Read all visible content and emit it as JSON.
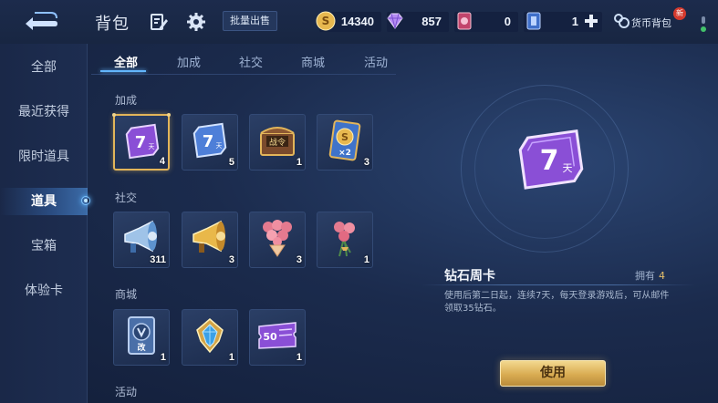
{
  "header": {
    "title": "背包",
    "bulk_sell": "批量出售",
    "currencies": {
      "coin": "14340",
      "diamond": "857",
      "card": "0",
      "ticket": "1"
    },
    "wallet_label": "货币背包",
    "new_badge": "新"
  },
  "sidebar": {
    "items": [
      {
        "label": "全部"
      },
      {
        "label": "最近获得"
      },
      {
        "label": "限时道具"
      },
      {
        "label": "道具"
      },
      {
        "label": "宝箱"
      },
      {
        "label": "体验卡"
      }
    ],
    "active": "道具"
  },
  "tabs": {
    "items": [
      {
        "label": "全部"
      },
      {
        "label": "加成"
      },
      {
        "label": "社交"
      },
      {
        "label": "商城"
      },
      {
        "label": "活动"
      }
    ],
    "active": "全部"
  },
  "sections": {
    "boost": {
      "label": "加成",
      "items": [
        {
          "icon": "diamond-week-card-icon",
          "qty": "4",
          "badge": "7",
          "badge_unit": "天"
        },
        {
          "icon": "blue-week-card-icon",
          "qty": "5",
          "badge": "7",
          "badge_unit": "天"
        },
        {
          "icon": "battle-pass-chest-icon",
          "qty": "1",
          "badge": "战令"
        },
        {
          "icon": "double-gold-card-icon",
          "qty": "3",
          "badge": "×2"
        }
      ]
    },
    "social": {
      "label": "社交",
      "items": [
        {
          "icon": "blue-megaphone-icon",
          "qty": "311"
        },
        {
          "icon": "gold-megaphone-icon",
          "qty": "3"
        },
        {
          "icon": "rose-bouquet-icon",
          "qty": "3"
        },
        {
          "icon": "rose-bunch-icon",
          "qty": "1"
        }
      ]
    },
    "shop": {
      "label": "商城",
      "items": [
        {
          "icon": "rename-card-icon",
          "qty": "1",
          "badge": "改"
        },
        {
          "icon": "crystal-crest-icon",
          "qty": "1"
        },
        {
          "icon": "purple-coupon-icon",
          "qty": "1",
          "badge": "50"
        }
      ]
    },
    "event": {
      "label": "活动"
    }
  },
  "detail": {
    "name": "钻石周卡",
    "owned_label": "拥有",
    "owned_count": "4",
    "description": "使用后第二日起，连续7天，每天登录游戏后，可从邮件领取35钻石。",
    "badge": "7",
    "badge_unit": "天",
    "use_button": "使用"
  },
  "colors": {
    "accent_gold": "#e2b55a",
    "accent_blue": "#63b6ff",
    "purple": "#8a4fd6"
  }
}
